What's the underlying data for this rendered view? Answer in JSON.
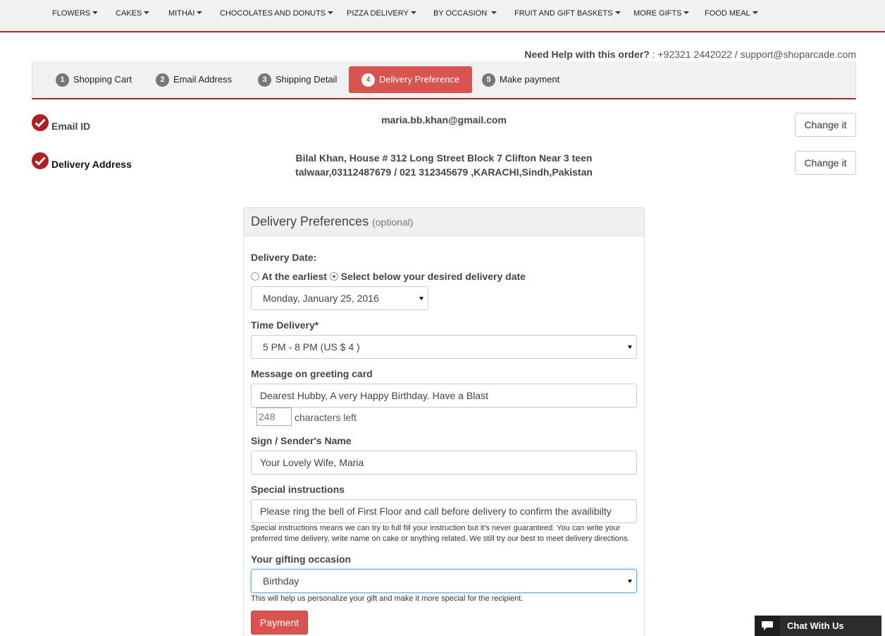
{
  "nav": {
    "items": [
      {
        "label": "FLOWERS"
      },
      {
        "label": "CAKES"
      },
      {
        "label": "MITHAI"
      },
      {
        "label": "CHOCOLATES AND DONUTS"
      },
      {
        "label": "PIZZA DELIVERY"
      },
      {
        "label": "BY OCCASION"
      },
      {
        "label": "FRUIT AND GIFT BASKETS"
      },
      {
        "label": "MORE GIFTS"
      },
      {
        "label": "FOOD MEAL"
      }
    ]
  },
  "help": {
    "label": "Need Help with this order?",
    "contact": ": +92321 2442022 / support@shoparcade.com"
  },
  "steps": [
    {
      "num": "1",
      "label": "Shopping Cart"
    },
    {
      "num": "2",
      "label": "Email Address"
    },
    {
      "num": "3",
      "label": "Shipping Detail"
    },
    {
      "num": "4",
      "label": "Delivery Preference"
    },
    {
      "num": "5",
      "label": "Make payment"
    }
  ],
  "summary": {
    "email_label": "Email ID",
    "email_value": "maria.bb.khan@gmail.com",
    "address_label": "Delivery Address",
    "address_line1": "Bilal Khan, House # 312 Long Street Block 7 Clifton Near 3 teen",
    "address_line2": "talwaar,03112487679 / 021 312345679 ,KARACHI,Sindh,Pakistan",
    "change_label": "Change it"
  },
  "panel": {
    "title": "Delivery Preferences",
    "optional": "(optional)",
    "date_label": "Delivery Date:",
    "radio_earliest": "At the earliest",
    "radio_select": "Select below your desired delivery date",
    "date_value": "Monday, January 25, 2016",
    "time_label": "Time Delivery*",
    "time_value": "5 PM - 8 PM (US $ 4 )",
    "message_label": "Message on greeting card",
    "message_value": "Dearest  Hubby, A very Happy Birthday. Have a Blast",
    "chars_count": "248",
    "chars_text": "characters left",
    "sign_label": "Sign / Sender's Name",
    "sign_value": "Your Lovely Wife, Maria",
    "instr_label": "Special instructions",
    "instr_value": "Please ring the bell of First Floor and call before delivery to confirm the availibilty",
    "instr_help": "Special instructions means we can try to full fill your instruction but it's never guaranteed. You can write your preferred time delivery, write name on cake or anything related. We still try our best to meet delivery directions.",
    "occasion_label": "Your gifting occasion",
    "occasion_value": "Birthday",
    "occasion_help": "This will help us personalize your gift and make it more special for the recipient.",
    "payment_label": "Payment"
  },
  "chat": {
    "label": "Chat With Us"
  },
  "colors": {
    "accent": "#d9534f",
    "brand_red": "#b8252c"
  }
}
